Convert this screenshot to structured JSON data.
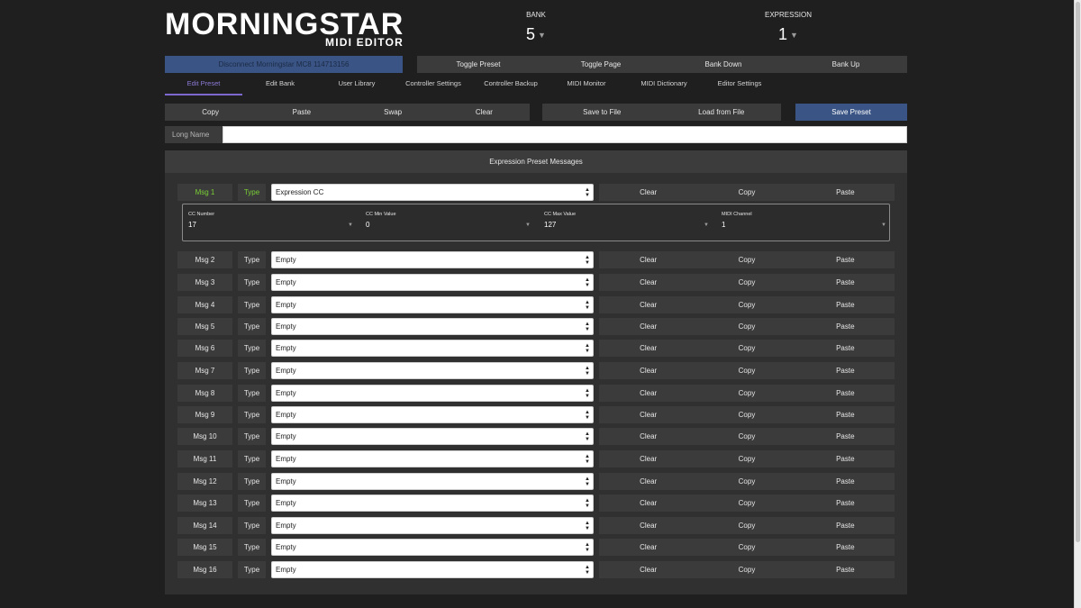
{
  "header": {
    "brand": "MORNINGSTAR",
    "subtitle": "MIDI EDITOR",
    "bank": {
      "label": "BANK",
      "value": "5"
    },
    "expression": {
      "label": "EXPRESSION",
      "value": "1"
    }
  },
  "connection": {
    "disconnect_label": "Disconnect Morningstar MC8 114713156"
  },
  "nav": {
    "toggle_preset": "Toggle Preset",
    "toggle_page": "Toggle Page",
    "bank_down": "Bank Down",
    "bank_up": "Bank Up"
  },
  "tabs": [
    "Edit Preset",
    "Edit Bank",
    "User Library",
    "Controller Settings",
    "Controller Backup",
    "MIDI Monitor",
    "MIDI Dictionary",
    "Editor Settings"
  ],
  "active_tab": "Edit Preset",
  "actions": {
    "copy": "Copy",
    "paste": "Paste",
    "swap": "Swap",
    "clear": "Clear",
    "save_to_file": "Save to File",
    "load_from_file": "Load from File",
    "save_preset": "Save Preset"
  },
  "long_name": {
    "label": "Long Name",
    "value": ""
  },
  "panel": {
    "title": "Expression Preset Messages"
  },
  "row_labels": {
    "type": "Type",
    "clear": "Clear",
    "copy": "Copy",
    "paste": "Paste"
  },
  "messages": [
    {
      "label": "Msg 1",
      "type": "Expression CC"
    },
    {
      "label": "Msg 2",
      "type": "Empty"
    },
    {
      "label": "Msg 3",
      "type": "Empty"
    },
    {
      "label": "Msg 4",
      "type": "Empty"
    },
    {
      "label": "Msg 5",
      "type": "Empty"
    },
    {
      "label": "Msg 6",
      "type": "Empty"
    },
    {
      "label": "Msg 7",
      "type": "Empty"
    },
    {
      "label": "Msg 8",
      "type": "Empty"
    },
    {
      "label": "Msg 9",
      "type": "Empty"
    },
    {
      "label": "Msg 10",
      "type": "Empty"
    },
    {
      "label": "Msg 11",
      "type": "Empty"
    },
    {
      "label": "Msg 12",
      "type": "Empty"
    },
    {
      "label": "Msg 13",
      "type": "Empty"
    },
    {
      "label": "Msg 14",
      "type": "Empty"
    },
    {
      "label": "Msg 15",
      "type": "Empty"
    },
    {
      "label": "Msg 16",
      "type": "Empty"
    }
  ],
  "msg1_details": [
    {
      "label": "CC Number",
      "value": "17"
    },
    {
      "label": "CC Min Value",
      "value": "0"
    },
    {
      "label": "CC Max Value",
      "value": "127"
    },
    {
      "label": "MIDI Channel",
      "value": "1"
    }
  ],
  "colors": {
    "accent_blue": "#3a5585",
    "active_green": "#7ad035",
    "active_tab": "#8d7bd8"
  }
}
